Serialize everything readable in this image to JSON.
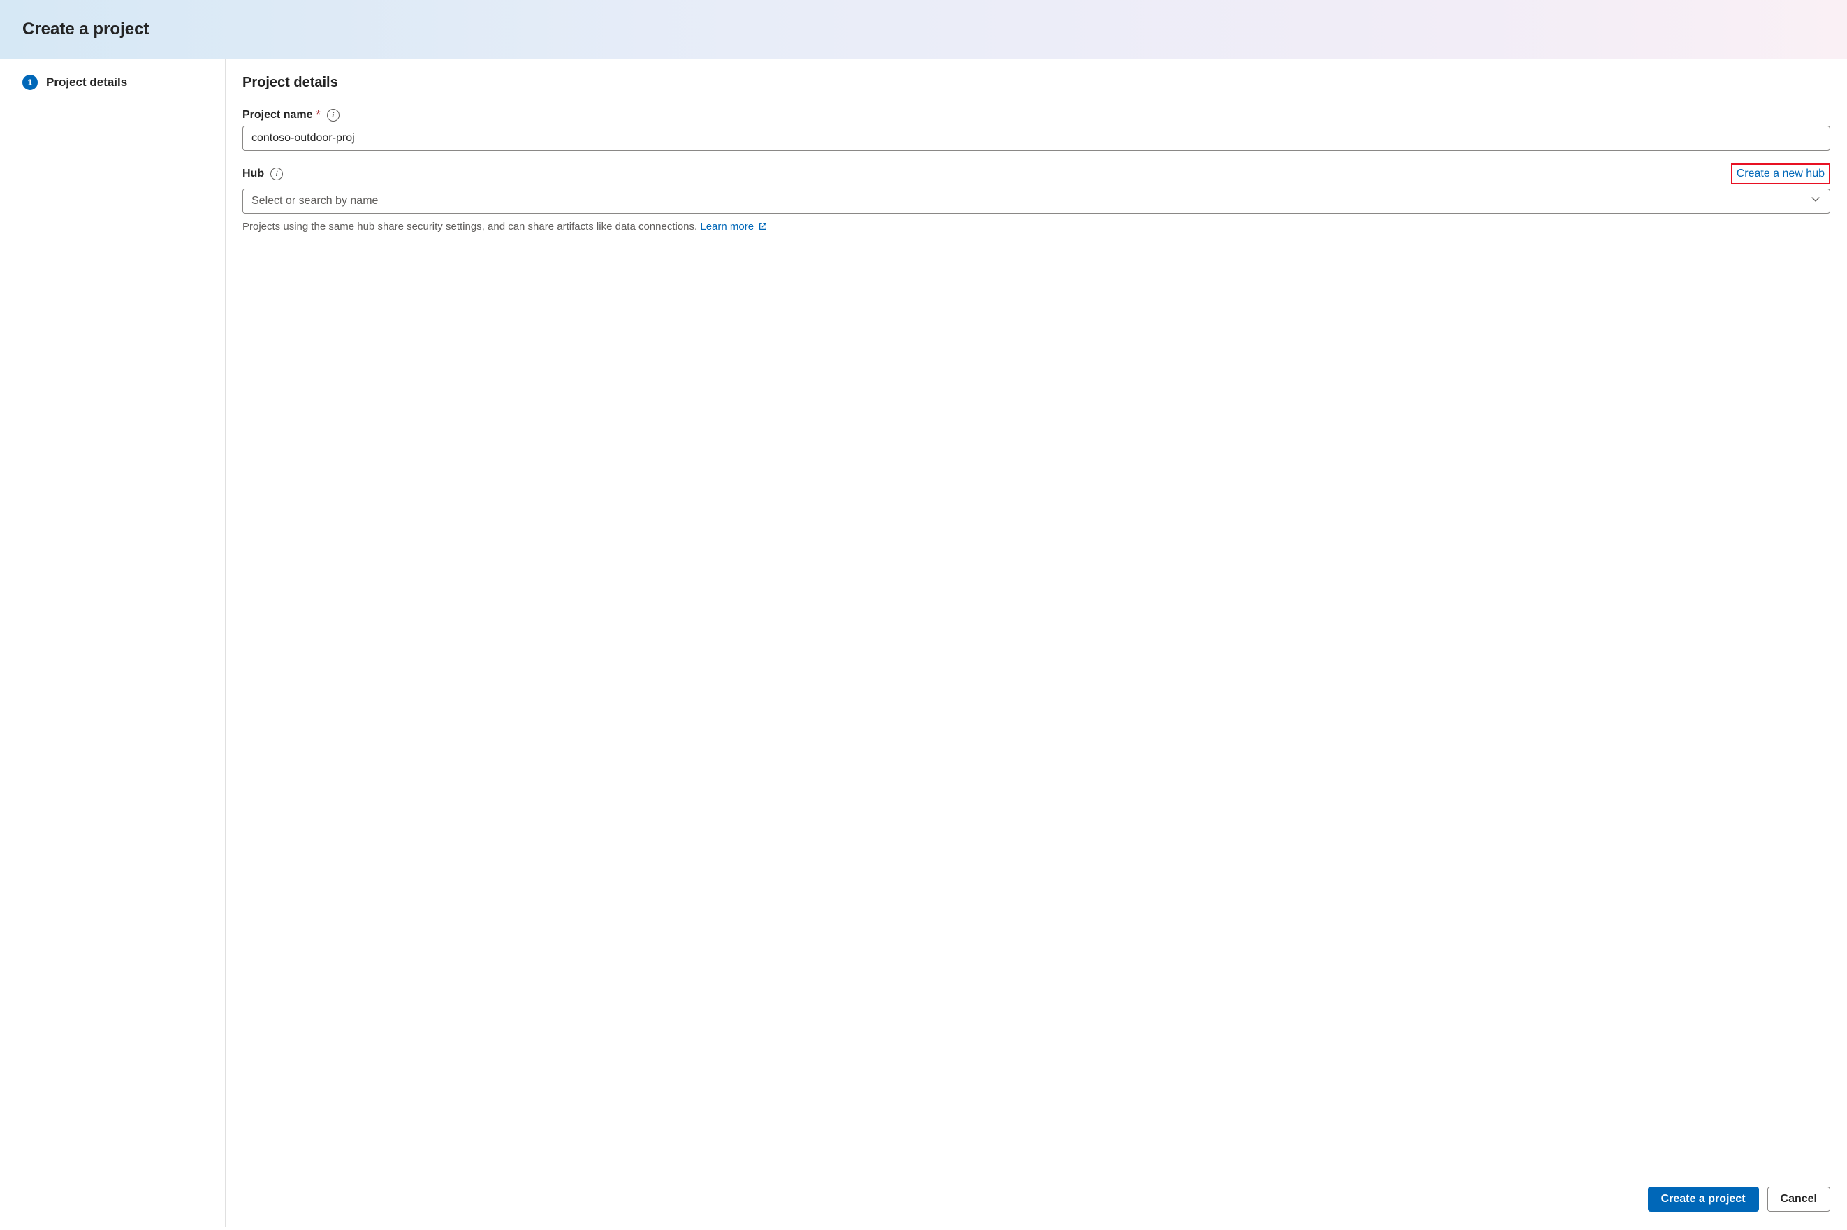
{
  "header": {
    "title": "Create a project"
  },
  "sidebar": {
    "step_number": "1",
    "step_label": "Project details"
  },
  "main": {
    "title": "Project details",
    "project_name": {
      "label": "Project name",
      "value": "contoso-outdoor-proj"
    },
    "hub": {
      "label": "Hub",
      "placeholder": "Select or search by name",
      "create_link": "Create a new hub",
      "helper_text": "Projects using the same hub share security settings, and can share artifacts like data connections. ",
      "learn_more": "Learn more"
    }
  },
  "footer": {
    "create": "Create a project",
    "cancel": "Cancel"
  }
}
